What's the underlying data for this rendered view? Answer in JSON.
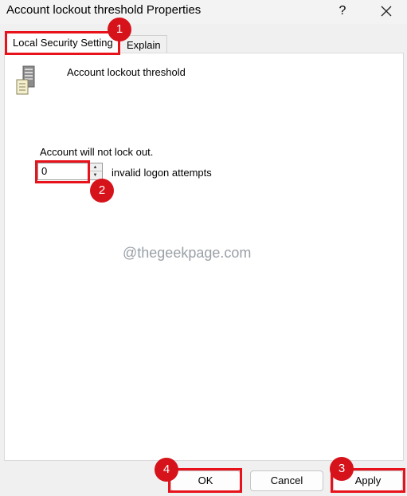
{
  "window": {
    "title": "Account lockout threshold Properties",
    "help_label": "?",
    "close_icon": "close-icon"
  },
  "tabs": [
    {
      "label": "Local Security Setting",
      "active": true
    },
    {
      "label": "Explain",
      "active": false
    }
  ],
  "policy": {
    "icon": "server-policy-icon",
    "name": "Account lockout threshold"
  },
  "setting": {
    "status": "Account will not lock out.",
    "value": "0",
    "suffix": "invalid logon attempts"
  },
  "watermark": "@thegeekpage.com",
  "buttons": {
    "ok": "OK",
    "cancel": "Cancel",
    "apply": "Apply"
  },
  "annotations": {
    "color": "#e8121b",
    "markers": [
      "1",
      "2",
      "3",
      "4"
    ]
  }
}
